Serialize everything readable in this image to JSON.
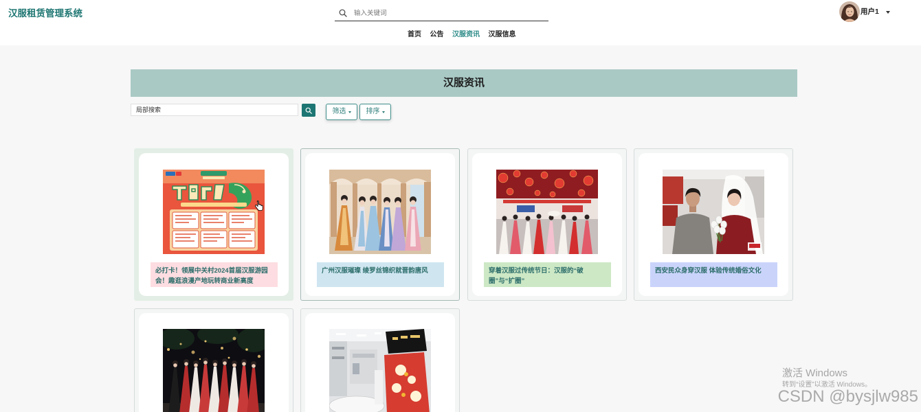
{
  "app": {
    "title": "汉服租赁管理系统"
  },
  "header_search": {
    "placeholder": "输入关键词",
    "icon": "search-icon"
  },
  "user": {
    "name": "用户1",
    "menu_icon": "caret-down-icon"
  },
  "nav": {
    "items": [
      {
        "label": "首页",
        "active": false
      },
      {
        "label": "公告",
        "active": false
      },
      {
        "label": "汉服资讯",
        "active": true
      },
      {
        "label": "汉服信息",
        "active": false
      }
    ]
  },
  "banner": {
    "title": "汉服资讯"
  },
  "toolbar": {
    "search_placeholder": "局部搜索",
    "search_button_icon": "search-icon",
    "filter_label": "筛选",
    "sort_label": "排序",
    "dropdown_icon": "caret-down-icon"
  },
  "cards": [
    {
      "title": "必打卡！领展中关村2024首届汉服游园会！趣逛浪漫产地玩转商业新高度",
      "title_bg": "#fddde1"
    },
    {
      "title": "广州汉服璀璨 绫罗丝锦织就晋韵唐风",
      "title_bg": "#cfe6f1"
    },
    {
      "title": "穿着汉服过传统节日：汉服的“破圈”与“扩圈”",
      "title_bg": "#cde8c5"
    },
    {
      "title": "西安民众身穿汉服 体验传统婚俗文化",
      "title_bg": "#cad4fb"
    }
  ],
  "watermark": {
    "activate_title": "激活 Windows",
    "activate_hint": "转到“设置”以激活 Windows。",
    "csdn": "CSDN @bysjlw985"
  },
  "colors": {
    "brand": "#1f7773",
    "nav_active": "#2a8a86",
    "banner_bg": "#a9c9c4",
    "page_bg": "#f7f7f7",
    "active_card_bg": "#e3eee6",
    "card_title_text": "#2d6e6b",
    "button_teal": "#1d7673"
  }
}
